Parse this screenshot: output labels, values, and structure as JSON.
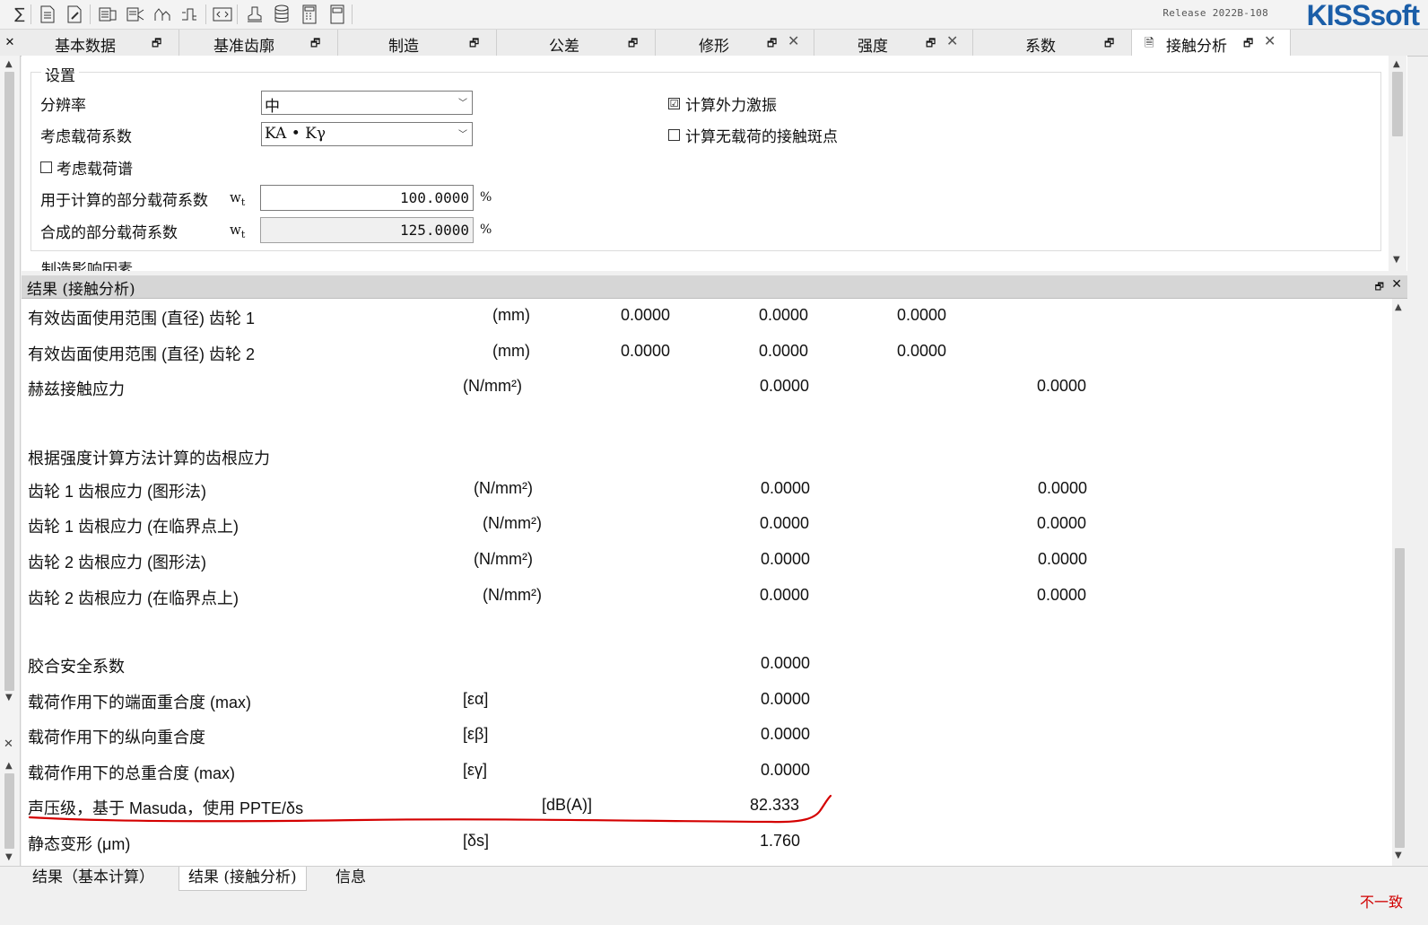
{
  "app": {
    "release": "Release 2022B-108",
    "logo": "KISSsoft"
  },
  "toolbar": {
    "icons": [
      "sum-icon",
      "document-icon",
      "document-edit-icon",
      "module-icon-1",
      "module-icon-2",
      "module-icon-3",
      "module-icon-4",
      "code-icon",
      "stamp-icon",
      "database-icon",
      "calculator-icon",
      "report-icon"
    ]
  },
  "tabs": [
    {
      "label": "基本数据"
    },
    {
      "label": "基准齿廓"
    },
    {
      "label": "制造"
    },
    {
      "label": "公差"
    },
    {
      "label": "修形"
    },
    {
      "label": "强度"
    },
    {
      "label": "系数"
    },
    {
      "label": "接触分析"
    }
  ],
  "settings": {
    "legend": "设置",
    "resolution_label": "分辨率",
    "resolution_value": "中",
    "load_factor_label": "考虑载荷系数",
    "load_factor_value": "KA • Kγ",
    "load_spectrum_label": "考虑载荷谱",
    "partial_load_label": "用于计算的部分载荷系数",
    "partial_load_symbol": "w",
    "partial_load_sub": "t",
    "partial_load_value": "100.0000",
    "partial_load_unit": "%",
    "combined_load_label": "合成的部分载荷系数",
    "combined_load_symbol": "w",
    "combined_load_sub": "t",
    "combined_load_value": "125.0000",
    "combined_load_unit": "%",
    "calc_excitation_label": "计算外力激振",
    "calc_excitation_checked": "☑",
    "calc_noload_label": "计算无载荷的接触斑点",
    "next_group_label": "制造影响因素"
  },
  "results": {
    "title": "结果 (接触分析)",
    "rows": [
      {
        "label": "有效齿面使用范围 (直径) 齿轮 1",
        "unit": "(mm)",
        "v1": "0.0000",
        "v2": "0.0000",
        "v3": "0.0000"
      },
      {
        "label": "有效齿面使用范围 (直径) 齿轮 2",
        "unit": "(mm)",
        "v1": "0.0000",
        "v2": "0.0000",
        "v3": "0.0000"
      },
      {
        "label": "赫兹接触应力",
        "unit": "(N/mm²)",
        "v2": "0.0000",
        "v4": "0.0000"
      },
      {
        "label": "根据强度计算方法计算的齿根应力"
      },
      {
        "label": "齿轮 1 齿根应力 (图形法)",
        "unit": "(N/mm²)",
        "v2": "0.0000",
        "v4": "0.0000"
      },
      {
        "label": "齿轮 1 齿根应力 (在临界点上)",
        "unit": "(N/mm²)",
        "v2": "0.0000",
        "v4": "0.0000"
      },
      {
        "label": "齿轮 2 齿根应力 (图形法)",
        "unit": "(N/mm²)",
        "v2": "0.0000",
        "v4": "0.0000"
      },
      {
        "label": "齿轮 2 齿根应力 (在临界点上)",
        "unit": "(N/mm²)",
        "v2": "0.0000",
        "v4": "0.0000"
      },
      {
        "label": "胶合安全系数",
        "v2": "0.0000"
      },
      {
        "label": "载荷作用下的端面重合度 (max)",
        "unit": "[εα]",
        "v2": "0.0000"
      },
      {
        "label": "载荷作用下的纵向重合度",
        "unit": "[εβ]",
        "v2": "0.0000"
      },
      {
        "label": "载荷作用下的总重合度 (max)",
        "unit": "[εγ]",
        "v2": "0.0000"
      },
      {
        "label": "声压级，基于 Masuda，使用 PPTE/δs",
        "unit": "[dB(A)]",
        "v2": "82.333"
      },
      {
        "label": "静态变形 (μm)",
        "unit": "[δs]",
        "v2": "1.760"
      }
    ]
  },
  "bottom_tabs": [
    {
      "label": "结果（基本计算）"
    },
    {
      "label": "结果 (接触分析)"
    },
    {
      "label": "信息"
    }
  ],
  "status_text": "不一致",
  "annotation_color": "#d40000"
}
